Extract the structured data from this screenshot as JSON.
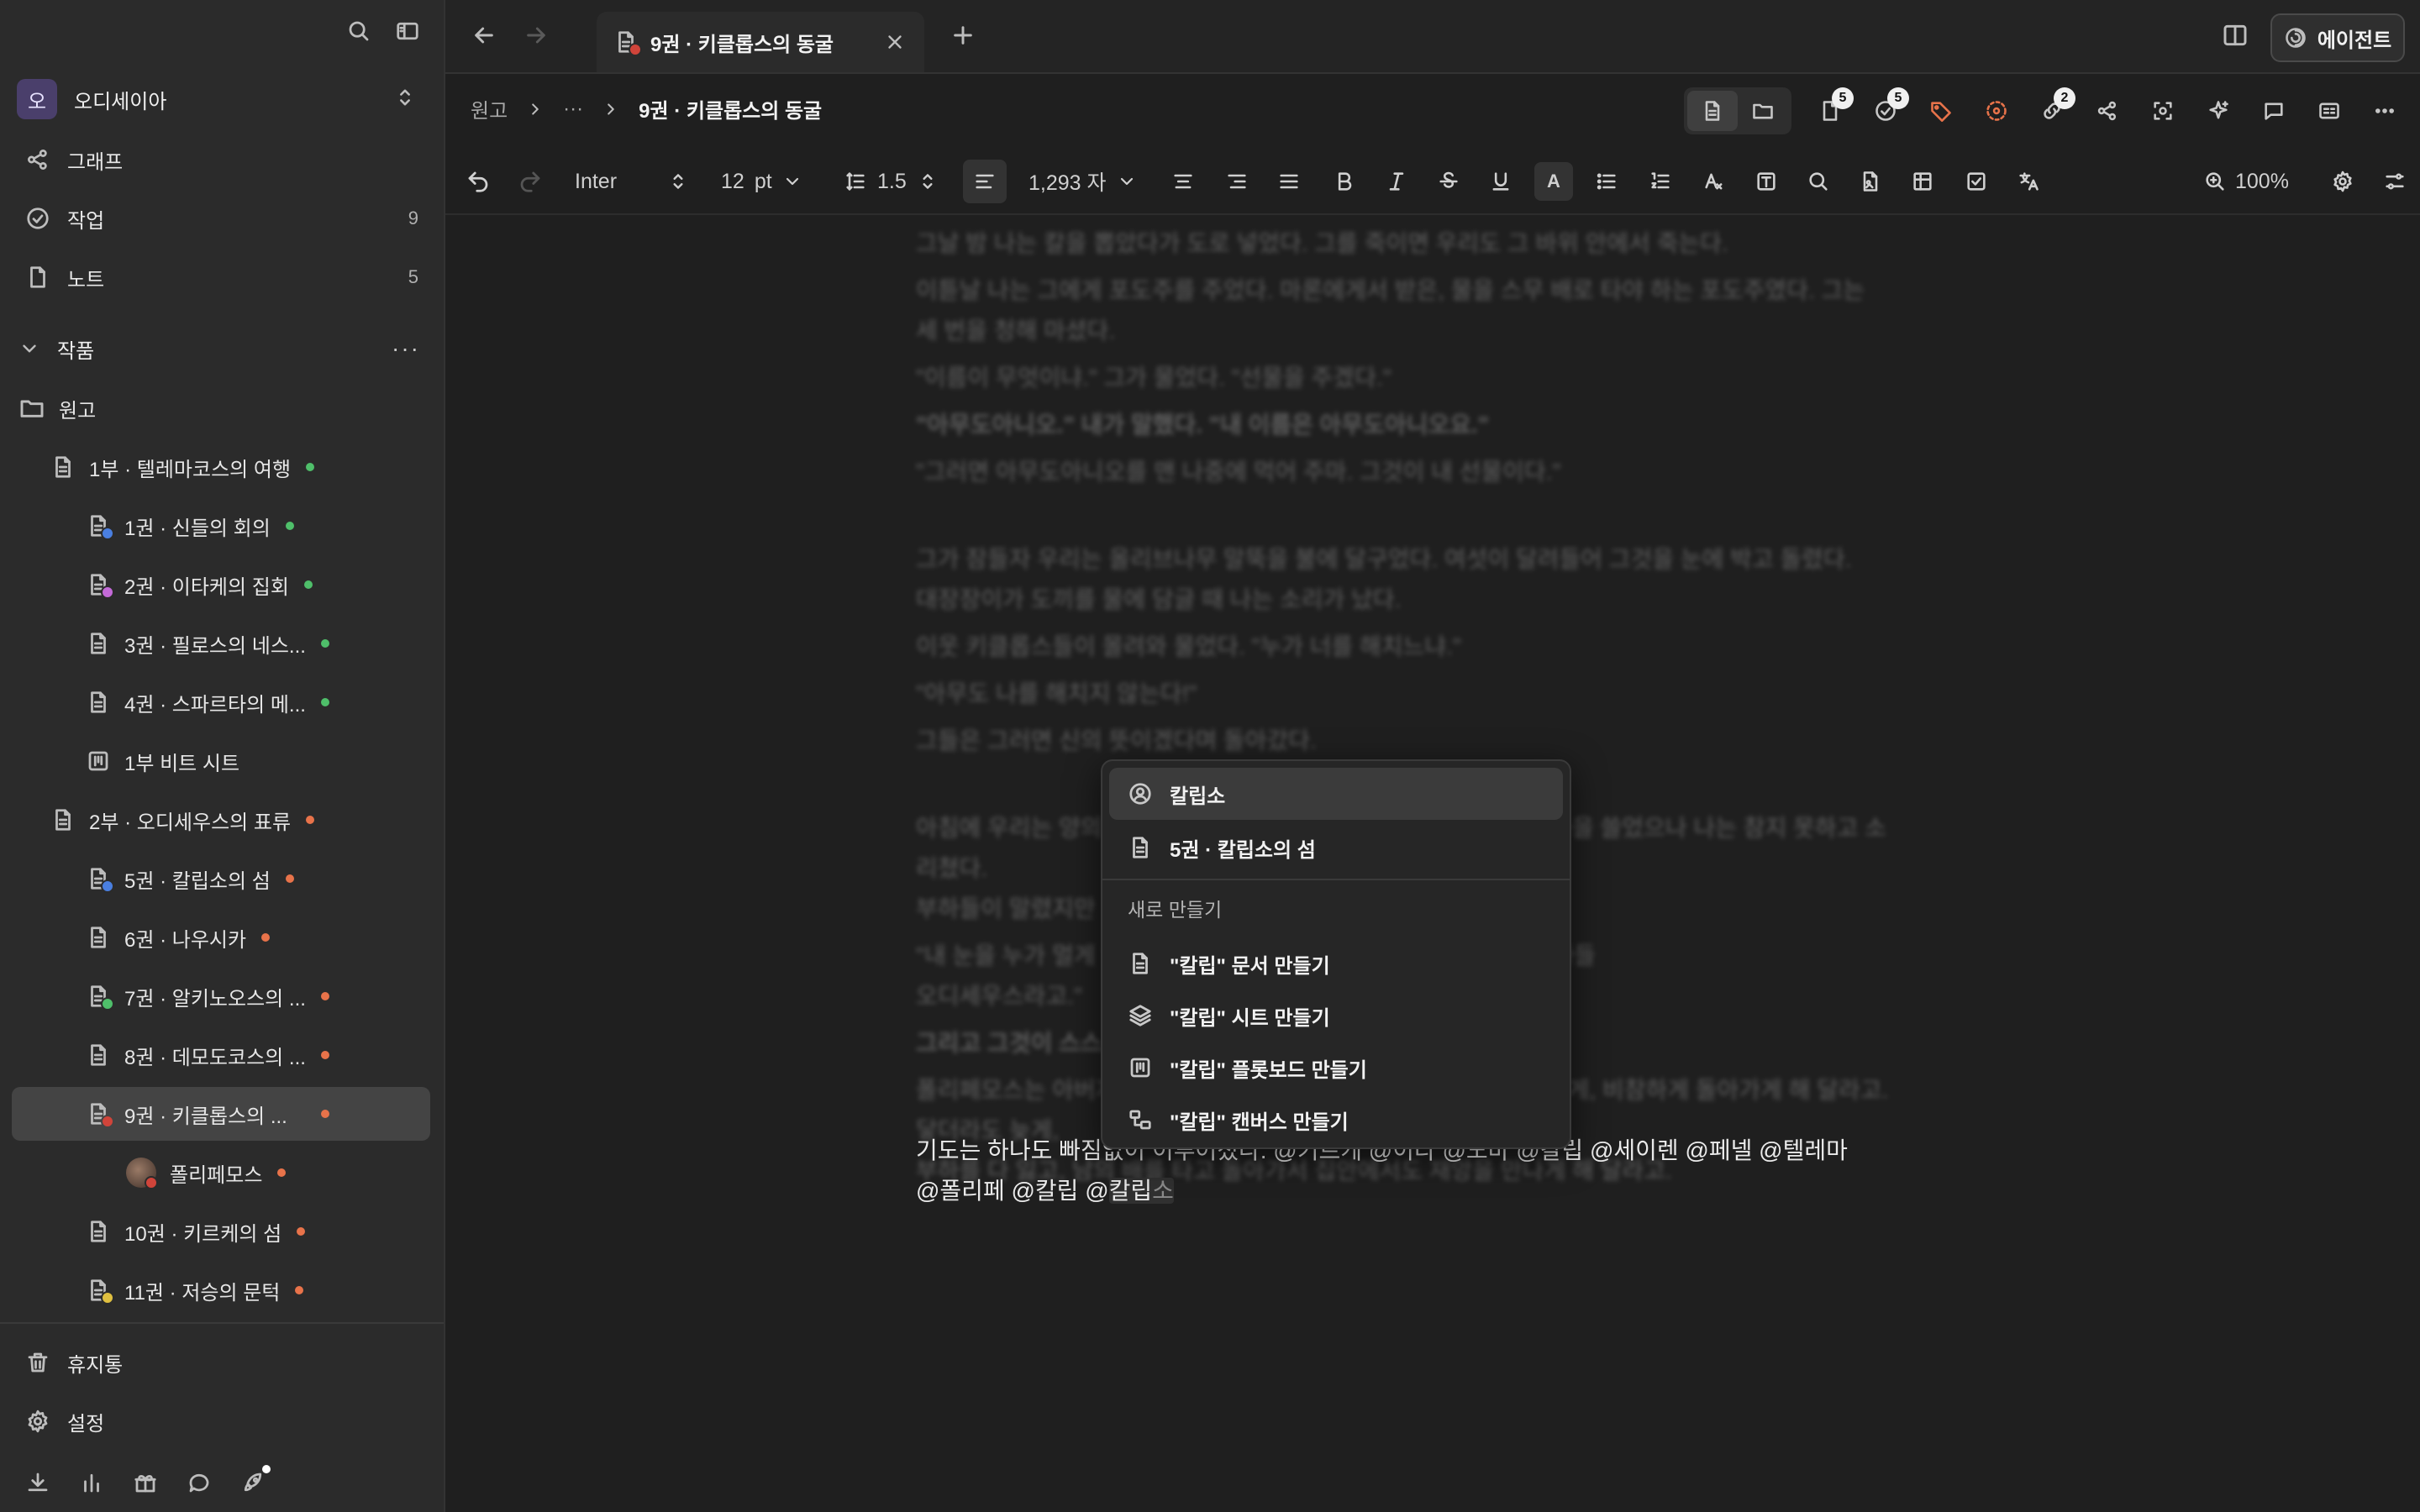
{
  "workspace": {
    "avatar": "오",
    "name": "오디세이아"
  },
  "nav": [
    {
      "label": "그래프",
      "count": ""
    },
    {
      "label": "작업",
      "count": "9"
    },
    {
      "label": "노트",
      "count": "5"
    }
  ],
  "section": {
    "label": "작품"
  },
  "tree": [
    {
      "label": "원고"
    },
    {
      "label": "1부 · 텔레마코스의 여행",
      "dot": "#4fbf6a"
    },
    {
      "label": "1권 · 신들의 회의",
      "dot": "#4fbf6a",
      "badge": "#4a7fe0"
    },
    {
      "label": "2권 · 이타케의 집회",
      "dot": "#4fbf6a",
      "badge": "#c46ad8"
    },
    {
      "label": "3권 · 필로스의 네스...",
      "dot": "#4fbf6a"
    },
    {
      "label": "4권 · 스파르타의 메...",
      "dot": "#4fbf6a"
    },
    {
      "label": "1부 비트 시트"
    },
    {
      "label": "2부 · 오디세우스의 표류",
      "dot": "#e8734a"
    },
    {
      "label": "5권 · 칼립소의 섬",
      "dot": "#e8734a",
      "badge": "#4a7fe0"
    },
    {
      "label": "6권 · 나우시카",
      "dot": "#e8734a"
    },
    {
      "label": "7권 · 알키노오스의 ...",
      "dot": "#e8734a",
      "badge": "#4fbf6a"
    },
    {
      "label": "8권 · 데모도코스의 ...",
      "dot": "#e8734a"
    },
    {
      "label": "9권 · 키클롭스의 ...",
      "dot": "#e8734a",
      "badge": "#d0443a"
    },
    {
      "label": "폴리페모스",
      "dot": "#e8734a"
    },
    {
      "label": "10권 · 키르케의 섬",
      "dot": "#e8734a"
    },
    {
      "label": "11권 · 저승의 문턱",
      "dot": "#e8734a",
      "badge": "#e0c040"
    }
  ],
  "footer": [
    {
      "label": "휴지통"
    },
    {
      "label": "설정"
    }
  ],
  "tab": {
    "title": "9권 · 키클롭스의 동굴"
  },
  "agent": {
    "label": "에이전트"
  },
  "breadcrumb": {
    "root": "원고",
    "ellipsis": "···",
    "current": "9권 · 키클롭스의 동굴"
  },
  "badges": {
    "docs": "5",
    "tasks": "5",
    "links": "2"
  },
  "toolbar": {
    "font": "Inter",
    "size": "12",
    "size_unit": "pt",
    "line_height": "1.5",
    "word_count": "1,293 자",
    "zoom": "100%"
  },
  "editor": {
    "blurred": [
      "그날 밤 나는 칼을 뽑았다가 도로 넣었다. 그를 죽이면 우리도 그 바위 안에서 죽는다.",
      "이튿날 나는 그에게 포도주를 주었다. 마론에게서 받은, 물을 스무 배로 타야 하는 포도주였다. 그는",
      "세 번을 청해 마셨다.",
      "\"이름이 무엇이냐.\" 그가 물었다. \"선물을 주겠다.\"",
      "\"아무도아니오.\" 내가 말했다. \"내 이름은 아무도아니오요.\"",
      "\"그러면 아무도아니오를 맨 나중에 먹어 주마. 그것이 내 선물이다.\"",
      "그가 잠들자 우리는 올리브나무 말뚝을 불에 달구었다. 여섯이 달려들어 그것을 눈에 박고 돌렸다.",
      "대장장이가 도끼를 물에 담글 때 나는 소리가 났다.",
      "이웃 키클롭스들이 몰려와 물었다. \"누가 너를 해치느냐.\"",
      "\"아무도 나를 해치지 않는다!\"",
      "그들은 그러면 신의 뜻이겠다며 돌아갔다.",
      "아침에 우리는 양의 배 밑에 매달려 동굴을 빠져나왔다. 그는 양의 등을 쓸었으나 나는 참지 못하고 소리쳤다.",
      "부하들이 말렸지만",
      "\"내 눈을 누가 멀게 했느냐고 묻거든, 이타케에 사는 라에르테스의 아들",
      "오디세우스라고.\"",
      "그리고 그것이 스스로",
      "폴리페모스는 아버지 포세이돈에게 기도했다. 그가 돌아가더라도 늦게, 비참하게 돌아가게 해 달라고. 닿더라도 늦게,",
      "부하를 다 잃고, 남의 배를 타고 돌아가서 집안에서도 재앙을 만나게 해 달라고."
    ],
    "line1_a": "기도는 하나도 빠짐없이 이루어졌다. @키르케 @이타 @노바 @칼립 @세이렌 @페넬 @텔레마",
    "line2_a": "@폴리페 @칼립 @",
    "line2_typed": "칼립",
    "line2_ghost": "소"
  },
  "popup": {
    "results": [
      {
        "label": "칼립소",
        "icon": "user-circle-icon"
      },
      {
        "label": "5권 · 칼립소의 섬",
        "icon": "document-icon"
      }
    ],
    "create_header": "새로 만들기",
    "create": [
      {
        "label": "\"칼립\" 문서 만들기",
        "icon": "document-icon"
      },
      {
        "label": "\"칼립\" 시트 만들기",
        "icon": "layers-icon"
      },
      {
        "label": "\"칼립\" 플롯보드 만들기",
        "icon": "kanban-icon"
      },
      {
        "label": "\"칼립\" 캔버스 만들기",
        "icon": "canvas-icon"
      }
    ]
  }
}
